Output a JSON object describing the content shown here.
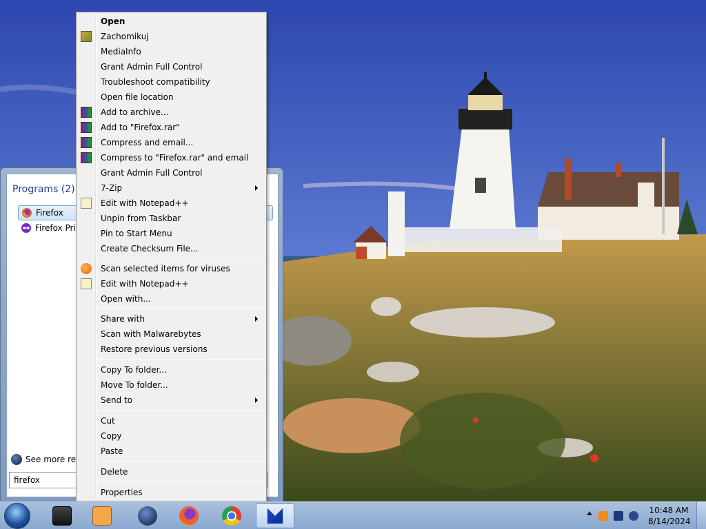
{
  "start_menu": {
    "programs_header": "Programs (2)",
    "programs": [
      {
        "label": "Firefox",
        "icon": "firefox-icon",
        "selected": true
      },
      {
        "label": "Firefox Pri",
        "icon": "firefox-private-icon",
        "selected": false
      }
    ],
    "see_more": "See more resu",
    "search_value": "firefox"
  },
  "context_menu": {
    "items": [
      {
        "label": "Open",
        "bold": true
      },
      {
        "label": "Zachomikuj",
        "icon": "zachomikuj-icon"
      },
      {
        "label": "MediaInfo"
      },
      {
        "label": "Grant Admin Full Control"
      },
      {
        "label": "Troubleshoot compatibility"
      },
      {
        "label": "Open file location"
      },
      {
        "label": "Add to archive...",
        "icon": "winrar-icon"
      },
      {
        "label": "Add to \"Firefox.rar\"",
        "icon": "winrar-icon"
      },
      {
        "label": "Compress and email...",
        "icon": "winrar-icon"
      },
      {
        "label": "Compress to \"Firefox.rar\" and email",
        "icon": "winrar-icon"
      },
      {
        "label": "Grant Admin Full Control"
      },
      {
        "label": "7-Zip",
        "submenu": true
      },
      {
        "label": "Edit with Notepad++",
        "icon": "notepadpp-icon"
      },
      {
        "label": "Unpin from Taskbar"
      },
      {
        "label": "Pin to Start Menu"
      },
      {
        "label": "Create Checksum File..."
      },
      {
        "label": "Scan selected items for viruses",
        "icon": "antivirus-scan-icon"
      },
      {
        "label": "Edit with Notepad++",
        "icon": "notepadpp-icon"
      },
      {
        "label": "Open with..."
      },
      {
        "label": "Share with",
        "submenu": true
      },
      {
        "label": "Scan with Malwarebytes"
      },
      {
        "label": "Restore previous versions"
      },
      {
        "label": "Copy To folder..."
      },
      {
        "label": "Move To folder..."
      },
      {
        "label": "Send to",
        "submenu": true
      },
      {
        "label": "Cut"
      },
      {
        "label": "Copy"
      },
      {
        "label": "Paste"
      },
      {
        "label": "Delete"
      },
      {
        "label": "Properties"
      }
    ]
  },
  "taskbar": {
    "apps": [
      "terminal-icon",
      "media-player-icon",
      "globe-icon",
      "firefox-icon",
      "chrome-icon",
      "malwarebytes-icon"
    ],
    "clock_time": "10:48 AM",
    "clock_date": "8/14/2024"
  }
}
